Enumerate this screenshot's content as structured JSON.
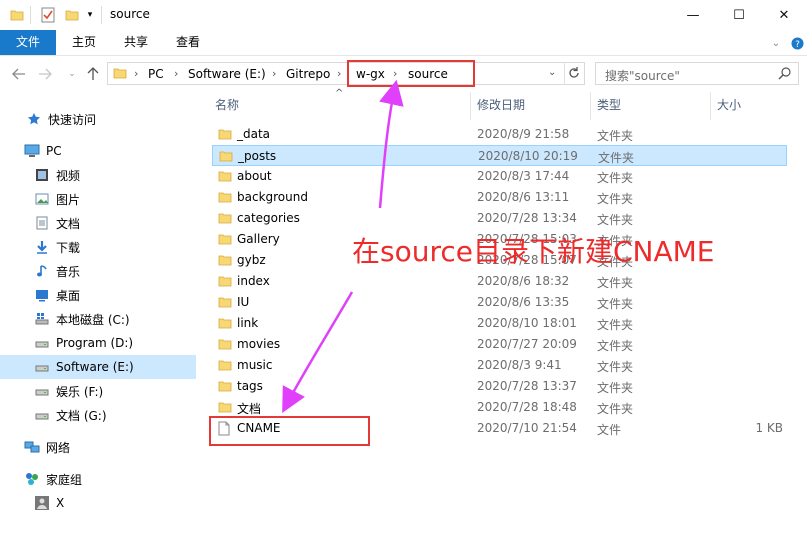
{
  "window": {
    "title": "source",
    "minimize": "—",
    "maximize": "☐",
    "close": "✕"
  },
  "ribbon": {
    "tabs": [
      "文件",
      "主页",
      "共享",
      "查看"
    ]
  },
  "address": {
    "path": [
      "PC",
      "Software (E:)",
      "Gitrepo",
      "w-gx",
      "source"
    ]
  },
  "search": {
    "placeholder": "搜索\"source\""
  },
  "nav": {
    "quick_access": "快速访问",
    "pc": "PC",
    "items": [
      "视频",
      "图片",
      "文档",
      "下载",
      "音乐",
      "桌面",
      "本地磁盘 (C:)",
      "Program (D:)",
      "Software (E:)",
      "娱乐 (F:)",
      "文档 (G:)"
    ],
    "network": "网络",
    "homegroup": "家庭组",
    "homegroup_user": "X"
  },
  "columns": {
    "name": "名称",
    "modified": "修改日期",
    "type": "类型",
    "size": "大小"
  },
  "files": [
    {
      "name": "_data",
      "date": "2020/8/9 21:58",
      "type": "文件夹",
      "size": ""
    },
    {
      "name": "_posts",
      "date": "2020/8/10 20:19",
      "type": "文件夹",
      "size": ""
    },
    {
      "name": "about",
      "date": "2020/8/3 17:44",
      "type": "文件夹",
      "size": ""
    },
    {
      "name": "background",
      "date": "2020/8/6 13:11",
      "type": "文件夹",
      "size": ""
    },
    {
      "name": "categories",
      "date": "2020/7/28 13:34",
      "type": "文件夹",
      "size": ""
    },
    {
      "name": "Gallery",
      "date": "2020/7/28 15:03",
      "type": "文件夹",
      "size": ""
    },
    {
      "name": "gybz",
      "date": "2020/7/28 15:07",
      "type": "文件夹",
      "size": ""
    },
    {
      "name": "index",
      "date": "2020/8/6 18:32",
      "type": "文件夹",
      "size": ""
    },
    {
      "name": "IU",
      "date": "2020/8/6 13:35",
      "type": "文件夹",
      "size": ""
    },
    {
      "name": "link",
      "date": "2020/8/10 18:01",
      "type": "文件夹",
      "size": ""
    },
    {
      "name": "movies",
      "date": "2020/7/27 20:09",
      "type": "文件夹",
      "size": ""
    },
    {
      "name": "music",
      "date": "2020/8/3 9:41",
      "type": "文件夹",
      "size": ""
    },
    {
      "name": "tags",
      "date": "2020/7/28 13:37",
      "type": "文件夹",
      "size": ""
    },
    {
      "name": "文档",
      "date": "2020/7/28 18:48",
      "type": "文件夹",
      "size": ""
    },
    {
      "name": "CNAME",
      "date": "2020/7/10 21:54",
      "type": "文件",
      "size": "1 KB"
    }
  ],
  "annotation": {
    "text": "在source目录下新建CNAME"
  },
  "colors": {
    "accent": "#1979ca",
    "selection": "#cce8ff",
    "annotation_red": "#e53935",
    "arrow_magenta": "#e040fb"
  }
}
